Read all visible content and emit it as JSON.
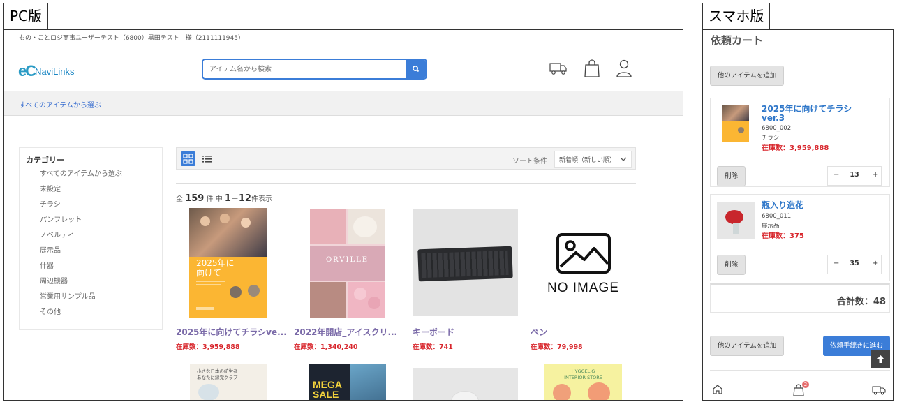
{
  "labels": {
    "pc": "PC版",
    "sp": "スマホ版"
  },
  "pc": {
    "user_line": "もの・ことロジ商事ユーザーテスト（6800）黒田テスト　様（2111111945）",
    "logo_text": "NaviLinks",
    "search_placeholder": "アイテム名から検索",
    "breadcrumb": "すべてのアイテムから選ぶ",
    "category_title": "カテゴリー",
    "categories": [
      "すべてのアイテムから選ぶ",
      "未設定",
      "チラシ",
      "パンフレット",
      "ノベルティ",
      "展示品",
      "什器",
      "周辺機器",
      "営業用サンプル品",
      "その他"
    ],
    "sort_label": "ソート条件",
    "sort_value": "新着順（新しい順）",
    "count": {
      "prefix": "全",
      "total": "159",
      "mid": "件 中",
      "range": "1−12",
      "suffix": "件表示"
    },
    "products": [
      {
        "name": "2025年に向けてチラシve...",
        "stock": "在庫数：3,959,888"
      },
      {
        "name": "2022年開店_アイスクリ...",
        "stock": "在庫数：1,340,240"
      },
      {
        "name": "キーボード",
        "stock": "在庫数：741"
      },
      {
        "name": "ペン",
        "stock": "在庫数：79,998"
      }
    ],
    "image_texts": {
      "flyer": "2025年に\n向けて",
      "orville": "ORVILLE",
      "no_image": "NO IMAGE",
      "mega_sale": "MEGA\nSALE",
      "poster2": "小さな日本の紡労者\nあなたに縁覚クラブ",
      "interior": "HYGGELIG\nINTERIOR STORE"
    }
  },
  "sp": {
    "title": "依頼カート",
    "add_button": "他のアイテムを追加",
    "items": [
      {
        "name": "2025年に向けてチラシ ver.3",
        "code": "6800_002",
        "category": "チラシ",
        "stock": "在庫数：3,959,888",
        "delete": "削除",
        "qty": "13"
      },
      {
        "name": "瓶入り造花",
        "code": "6800_011",
        "category": "展示品",
        "stock": "在庫数：375",
        "delete": "削除",
        "qty": "35"
      }
    ],
    "total": "合計数：48",
    "add_button_bottom": "他のアイテムを追加",
    "proceed_button": "依頼手続きに進む",
    "cart_badge": "2"
  }
}
